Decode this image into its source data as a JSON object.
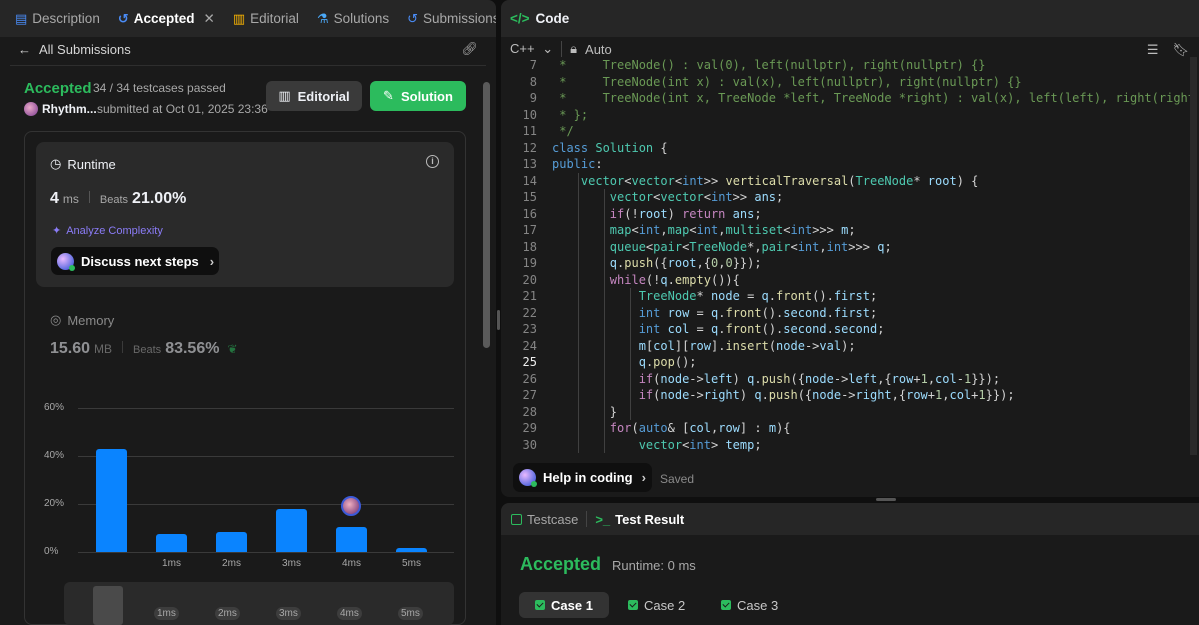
{
  "left_tabs": [
    {
      "label": "Description",
      "icon": "document-icon",
      "active": false
    },
    {
      "label": "Accepted",
      "icon": "history-icon",
      "active": true
    },
    {
      "label": "Editorial",
      "icon": "book-icon",
      "active": false
    },
    {
      "label": "Solutions",
      "icon": "flask-icon",
      "active": false
    },
    {
      "label": "Submissions",
      "icon": "history-icon",
      "active": false
    }
  ],
  "subheader": {
    "back_label": "All Submissions"
  },
  "submission": {
    "status": "Accepted",
    "testcases": "34 / 34 testcases passed",
    "user": "Rhythm...",
    "submitted_at": "submitted at Oct 01, 2025 23:36",
    "editorial_button": "Editorial",
    "solution_button": "Solution"
  },
  "runtime": {
    "label": "Runtime",
    "value": "4",
    "unit": "ms",
    "beats_label": "Beats",
    "beats": "21.00%",
    "analyze": "Analyze Complexity",
    "discuss": "Discuss next steps"
  },
  "memory": {
    "label": "Memory",
    "value": "15.60",
    "unit": "MB",
    "beats_label": "Beats",
    "beats": "83.56%"
  },
  "chart_data": {
    "type": "bar",
    "categories": [
      "",
      "1ms",
      "2ms",
      "3ms",
      "4ms",
      "5ms"
    ],
    "values": [
      43,
      7.5,
      8.5,
      18,
      10.5,
      1.5
    ],
    "yticks": [
      "60%",
      "40%",
      "20%",
      "0%"
    ],
    "ylim": [
      0,
      60
    ],
    "highlight_index": 4,
    "bar_color": "#0a84ff",
    "brush_ticks": [
      "1ms",
      "2ms",
      "3ms",
      "4ms",
      "5ms"
    ]
  },
  "code_panel": {
    "title": "Code",
    "language": "C++",
    "mode": "Auto",
    "help": "Help in coding",
    "saved": "Saved"
  },
  "code_lines": [
    {
      "n": "7",
      "html": "<span class=\"c\"> *     TreeNode() : val(0), left(nullptr), right(nullptr) {}</span>"
    },
    {
      "n": "8",
      "html": "<span class=\"c\"> *     TreeNode(int x) : val(x), left(nullptr), right(nullptr) {}</span>"
    },
    {
      "n": "9",
      "html": "<span class=\"c\"> *     TreeNode(int x, TreeNode *left, TreeNode *right) : val(x), left(left), right(right) {}</span>"
    },
    {
      "n": "10",
      "html": "<span class=\"c\"> * };</span>"
    },
    {
      "n": "11",
      "html": "<span class=\"c\"> */</span>"
    },
    {
      "n": "12",
      "html": "<span class=\"k\">class</span> <span class=\"t\">Solution</span> {"
    },
    {
      "n": "13",
      "html": "<span class=\"k\">public</span>:"
    },
    {
      "n": "14",
      "html": "    <span class=\"t\">vector</span>&lt;<span class=\"t\">vector</span>&lt;<span class=\"k\">int</span>&gt;&gt; <span class=\"f\">verticalTraversal</span>(<span class=\"t\">TreeNode</span>* <span class=\"v\">root</span>) {"
    },
    {
      "n": "15",
      "html": "        <span class=\"t\">vector</span>&lt;<span class=\"t\">vector</span>&lt;<span class=\"k\">int</span>&gt;&gt; <span class=\"v\">ans</span>;"
    },
    {
      "n": "16",
      "html": "        <span class=\"kw\">if</span>(!<span class=\"v\">root</span>) <span class=\"kw\">return</span> <span class=\"v\">ans</span>;"
    },
    {
      "n": "17",
      "html": "        <span class=\"t\">map</span>&lt;<span class=\"k\">int</span>,<span class=\"t\">map</span>&lt;<span class=\"k\">int</span>,<span class=\"t\">multiset</span>&lt;<span class=\"k\">int</span>&gt;&gt;&gt; <span class=\"v\">m</span>;"
    },
    {
      "n": "18",
      "html": "        <span class=\"t\">queue</span>&lt;<span class=\"t\">pair</span>&lt;<span class=\"t\">TreeNode</span>*,<span class=\"t\">pair</span>&lt;<span class=\"k\">int</span>,<span class=\"k\">int</span>&gt;&gt;&gt; <span class=\"v\">q</span>;"
    },
    {
      "n": "19",
      "html": "        <span class=\"v\">q</span>.<span class=\"f\">push</span>({<span class=\"v\">root</span>,{<span class=\"n\">0</span>,<span class=\"n\">0</span>}});"
    },
    {
      "n": "20",
      "html": "        <span class=\"kw\">while</span>(!<span class=\"v\">q</span>.<span class=\"f\">empty</span>()){"
    },
    {
      "n": "21",
      "html": "            <span class=\"t\">TreeNode</span>* <span class=\"v\">node</span> = <span class=\"v\">q</span>.<span class=\"f\">front</span>().<span class=\"v\">first</span>;"
    },
    {
      "n": "22",
      "html": "            <span class=\"k\">int</span> <span class=\"v\">row</span> = <span class=\"v\">q</span>.<span class=\"f\">front</span>().<span class=\"v\">second</span>.<span class=\"v\">first</span>;"
    },
    {
      "n": "23",
      "html": "            <span class=\"k\">int</span> <span class=\"v\">col</span> = <span class=\"v\">q</span>.<span class=\"f\">front</span>().<span class=\"v\">second</span>.<span class=\"v\">second</span>;"
    },
    {
      "n": "24",
      "html": "            <span class=\"v\">m</span>[<span class=\"v\">col</span>][<span class=\"v\">row</span>].<span class=\"f\">insert</span>(<span class=\"v\">node</span>-&gt;<span class=\"v\">val</span>);"
    },
    {
      "n": "25",
      "html": "            <span class=\"v\">q</span>.<span class=\"f\">pop</span>();"
    },
    {
      "n": "26",
      "html": "            <span class=\"kw\">if</span>(<span class=\"v\">node</span>-&gt;<span class=\"v\">left</span>) <span class=\"v\">q</span>.<span class=\"f\">push</span>({<span class=\"v\">node</span>-&gt;<span class=\"v\">left</span>,{<span class=\"v\">row</span>+<span class=\"n\">1</span>,<span class=\"v\">col</span>-<span class=\"n\">1</span>}});"
    },
    {
      "n": "27",
      "html": "            <span class=\"kw\">if</span>(<span class=\"v\">node</span>-&gt;<span class=\"v\">right</span>) <span class=\"v\">q</span>.<span class=\"f\">push</span>({<span class=\"v\">node</span>-&gt;<span class=\"v\">right</span>,{<span class=\"v\">row</span>+<span class=\"n\">1</span>,<span class=\"v\">col</span>+<span class=\"n\">1</span>}});"
    },
    {
      "n": "28",
      "html": "        }"
    },
    {
      "n": "29",
      "html": "        <span class=\"kw\">for</span>(<span class=\"k\">auto</span>&amp; [<span class=\"v\">col</span>,<span class=\"v\">row</span>] : <span class=\"v\">m</span>){"
    },
    {
      "n": "30",
      "html": "            <span class=\"t\">vector</span>&lt;<span class=\"k\">int</span>&gt; <span class=\"v\">temp</span>;"
    }
  ],
  "current_line": "25",
  "test_panel": {
    "tabs": [
      {
        "label": "Testcase",
        "active": false
      },
      {
        "label": "Test Result",
        "active": true
      }
    ],
    "result": "Accepted",
    "runtime": "Runtime: 0 ms",
    "cases": [
      {
        "label": "Case 1",
        "active": true
      },
      {
        "label": "Case 2",
        "active": false
      },
      {
        "label": "Case 3",
        "active": false
      }
    ]
  }
}
